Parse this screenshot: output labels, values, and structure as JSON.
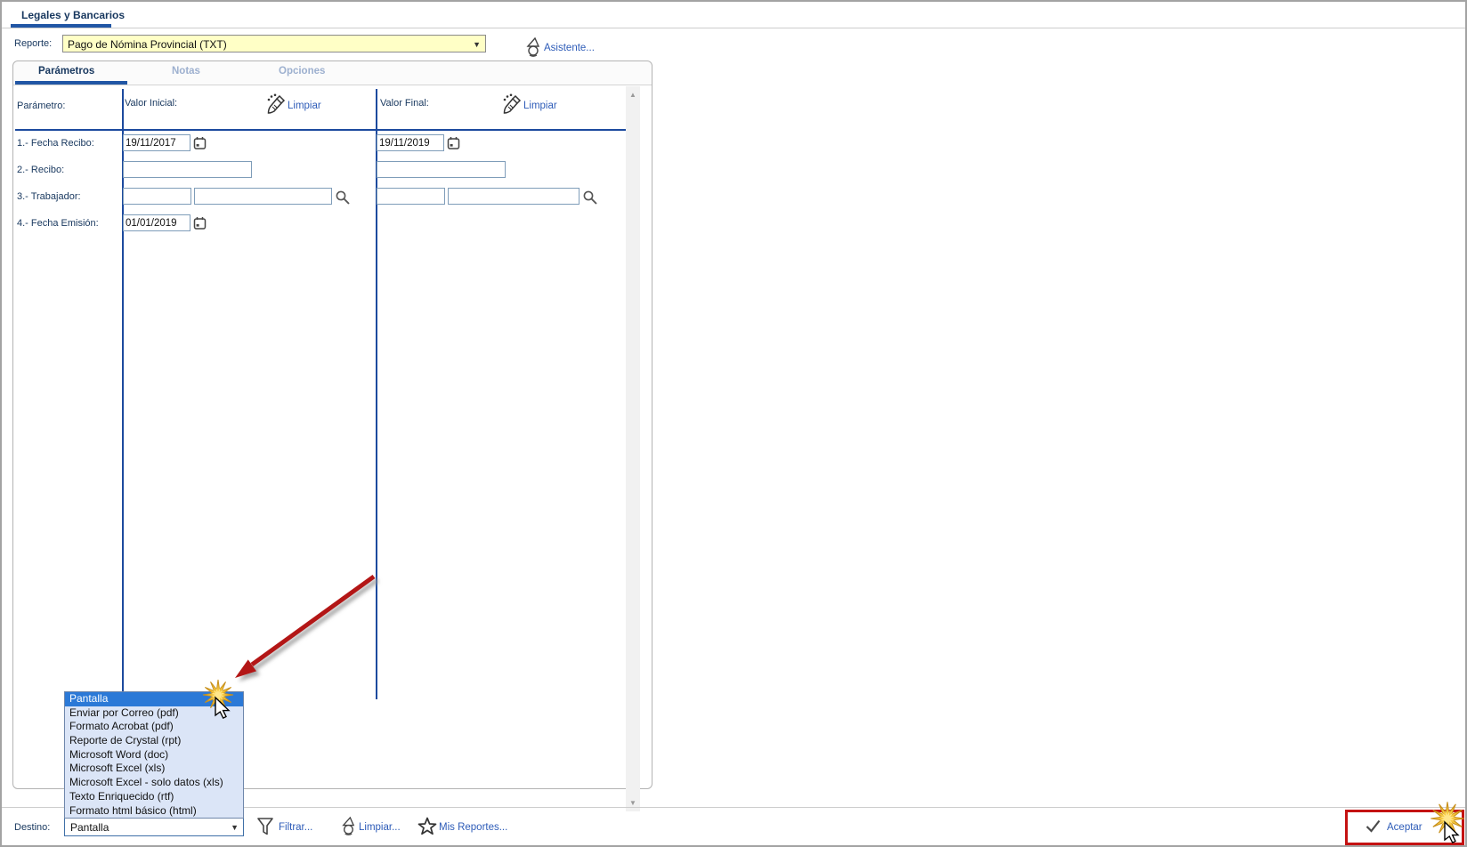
{
  "page": {
    "title": "Legales y Bancarios"
  },
  "report": {
    "label": "Reporte:",
    "selected": "Pago de Nómina Provincial (TXT)",
    "assistant": "Asistente..."
  },
  "tabs": {
    "parameters": "Parámetros",
    "notes": "Notas",
    "options": "Opciones"
  },
  "param_table": {
    "col_parameter": "Parámetro:",
    "col_initial": "Valor Inicial:",
    "col_final": "Valor Final:",
    "clear_initial": "Limpiar",
    "clear_final": "Limpiar",
    "rows": [
      {
        "label": "1.- Fecha Recibo:",
        "initial": "19/11/2017",
        "final": "19/11/2019"
      },
      {
        "label": "2.- Recibo:",
        "initial": "",
        "final": ""
      },
      {
        "label": "3.- Trabajador:",
        "initial_code": "",
        "initial_name": "",
        "final_code": "",
        "final_name": ""
      },
      {
        "label": "4.- Fecha Emisión:",
        "initial": "01/01/2019"
      }
    ]
  },
  "destination": {
    "label": "Destino:",
    "selected": "Pantalla",
    "options": [
      "Pantalla",
      "Enviar por Correo (pdf)",
      "Formato Acrobat (pdf)",
      "Reporte de Crystal (rpt)",
      "Microsoft Word (doc)",
      "Microsoft Excel (xls)",
      "Microsoft Excel - solo datos (xls)",
      "Texto Enriquecido (rtf)",
      "Formato html básico (html)"
    ]
  },
  "actions": {
    "filter": "Filtrar...",
    "clear": "Limpiar...",
    "my_reports": "Mis Reportes...",
    "accept": "Aceptar"
  },
  "icons": {
    "assistant": "wizard-icon",
    "clear_header": "broom-icon",
    "date": "calendar-icon",
    "lookup": "magnifier-icon",
    "filter": "funnel-icon",
    "my_reports": "star-icon",
    "accept": "check-icon"
  },
  "colors": {
    "navy_text": "#17375e",
    "link_blue": "#2e5cb8",
    "accent_blue": "#2156a5",
    "table_line_blue": "#1c4a9e",
    "dropdown_highlight": "#2b79d7",
    "dropdown_bg": "#dbe5f7",
    "report_select_bg": "#ffffc6",
    "callout_red": "#c41212",
    "starburst_gold": "#f5c63f"
  }
}
